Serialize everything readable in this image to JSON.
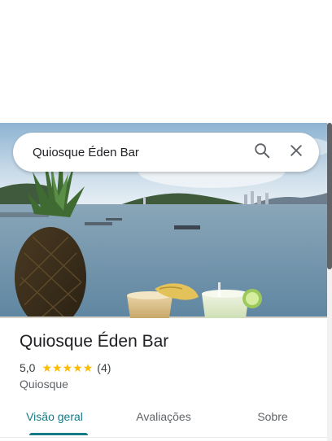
{
  "search": {
    "value": "Quiosque Éden Bar",
    "search_icon": "search-icon",
    "close_icon": "close-icon"
  },
  "place": {
    "name": "Quiosque Éden Bar",
    "rating": "5,0",
    "star_count": 5,
    "review_count": "(4)",
    "category": "Quiosque"
  },
  "tabs": [
    {
      "label": "Visão geral",
      "active": true
    },
    {
      "label": "Avaliações",
      "active": false
    },
    {
      "label": "Sobre",
      "active": false
    }
  ],
  "colors": {
    "accent": "#137a86",
    "star": "#fbbc04"
  }
}
